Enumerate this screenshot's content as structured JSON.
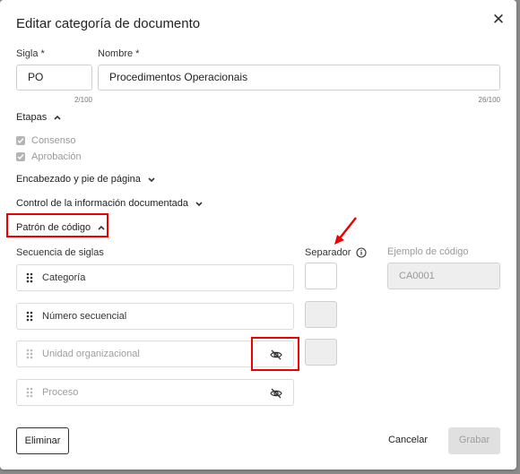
{
  "dialog": {
    "title": "Editar categoría de documento",
    "close_icon": "close-icon"
  },
  "form": {
    "sigla_label": "Sigla *",
    "sigla_value": "PO",
    "sigla_counter": "2/100",
    "nombre_label": "Nombre *",
    "nombre_value": "Procedimentos Operacionais",
    "nombre_counter": "26/100"
  },
  "etapas": {
    "label": "Etapas",
    "expanded": true,
    "items": [
      {
        "label": "Consenso",
        "checked": true
      },
      {
        "label": "Aprobación",
        "checked": true
      }
    ]
  },
  "sections": {
    "encabezado": {
      "label": "Encabezado y pie de página",
      "expanded": false
    },
    "control": {
      "label": "Control de la información documentada",
      "expanded": false
    },
    "patron": {
      "label": "Patrón de código",
      "expanded": true
    }
  },
  "patron": {
    "secuencia_label": "Secuencia de siglas",
    "separador_label": "Separador",
    "ejemplo_label": "Ejemplo de código",
    "ejemplo_value": "CA0001",
    "items": [
      {
        "label": "Categoría",
        "visible": true
      },
      {
        "label": "Número secuencial",
        "visible": true
      },
      {
        "label": "Unidad organizacional",
        "visible": false
      },
      {
        "label": "Proceso",
        "visible": false
      }
    ]
  },
  "footer": {
    "delete_label": "Eliminar",
    "cancel_label": "Cancelar",
    "save_label": "Grabar"
  },
  "colors": {
    "annotation": "#e00000",
    "disabled_button": "#e0e0e0"
  }
}
